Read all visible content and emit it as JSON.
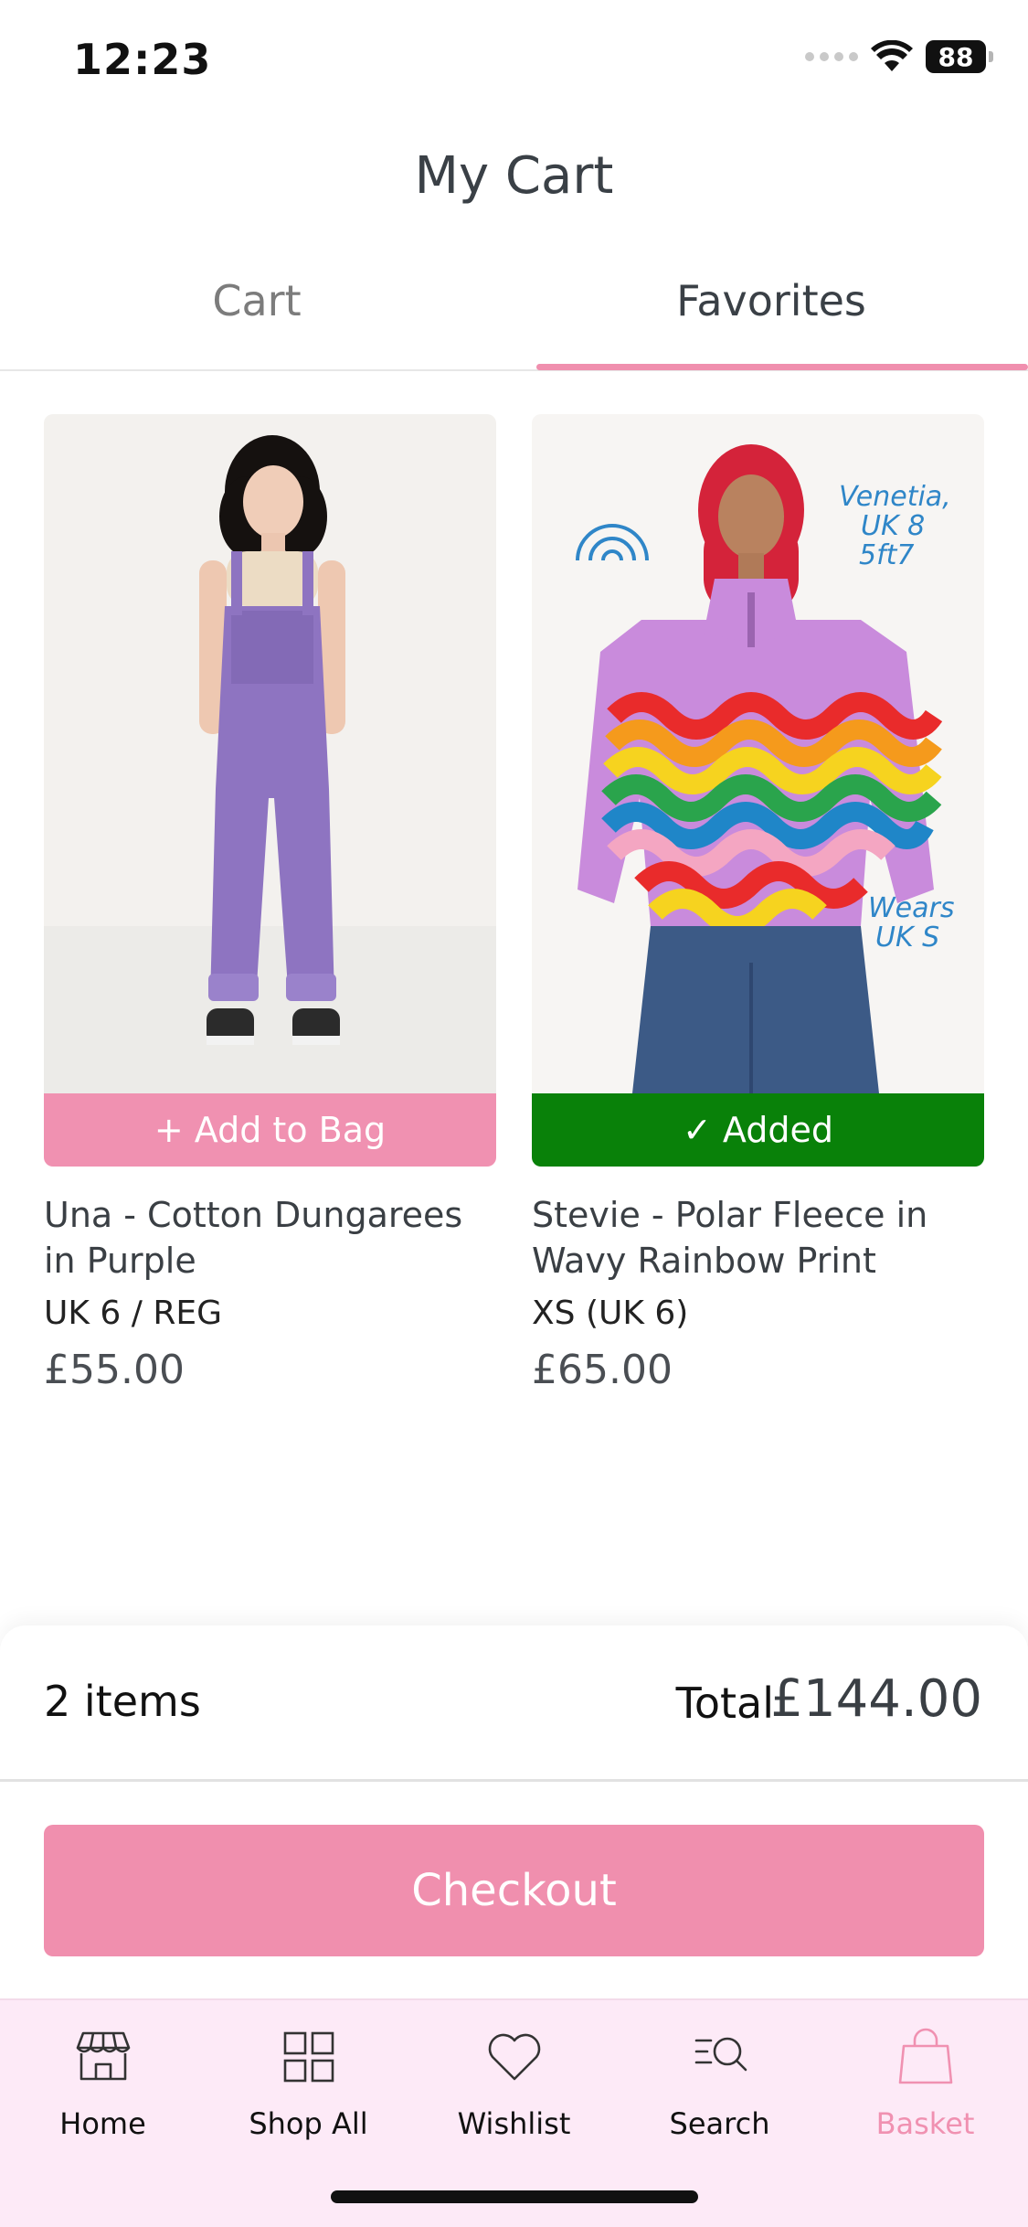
{
  "status_bar": {
    "time": "12:23",
    "battery": "88"
  },
  "header": {
    "title": "My Cart"
  },
  "tabs": [
    {
      "label": "Cart",
      "active": false
    },
    {
      "label": "Favorites",
      "active": true
    }
  ],
  "products": [
    {
      "name": "Una - Cotton Dungarees in Purple",
      "size": "UK 6 / REG",
      "price": "£55.00",
      "button_label": "+ Add to Bag",
      "button_state": "add"
    },
    {
      "name": "Stevie - Polar Fleece in Wavy Rainbow Print",
      "size": "XS (UK 6)",
      "price": "£65.00",
      "button_label": "✓ Added",
      "button_state": "added",
      "image_annotations": [
        "Venetia,",
        "UK 8",
        "5ft7",
        "Wears",
        "UK S"
      ]
    }
  ],
  "summary": {
    "items_count": "2 items",
    "total_label": "Total",
    "total_value": "£144.00",
    "checkout_label": "Checkout"
  },
  "bottom_nav": [
    {
      "label": "Home",
      "icon": "storefront-icon",
      "active": false
    },
    {
      "label": "Shop All",
      "icon": "grid-icon",
      "active": false
    },
    {
      "label": "Wishlist",
      "icon": "heart-icon",
      "active": false
    },
    {
      "label": "Search",
      "icon": "search-icon",
      "active": false
    },
    {
      "label": "Basket",
      "icon": "bag-icon",
      "active": true
    }
  ],
  "colors": {
    "accent_pink": "#f091b1",
    "added_green": "#098109",
    "nav_background": "#fdeaf7",
    "text_dark": "#3a3f44"
  }
}
